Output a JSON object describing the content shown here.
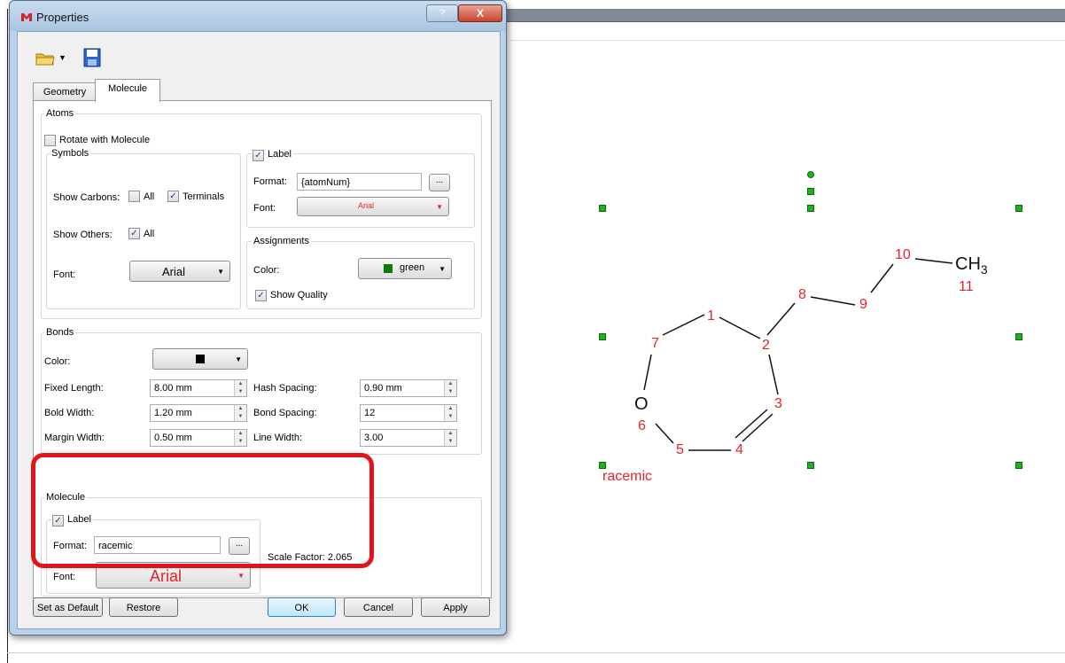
{
  "window": {
    "title": "Properties",
    "help_label": "?",
    "close_label": "X"
  },
  "icons": {
    "app": "app-logo-icon",
    "folder": "open-folder-icon",
    "dropdown": "dropdown-arrow-icon",
    "save": "save-icon"
  },
  "tabs": [
    "Geometry",
    "Molecule"
  ],
  "atoms": {
    "group_label": "Atoms",
    "rotate_label": "Rotate with Molecule",
    "rotate_checked": false,
    "symbols": {
      "group_label": "Symbols",
      "show_carbons_label": "Show Carbons:",
      "all_label": "All",
      "all_checked": false,
      "terminals_label": "Terminals",
      "terminals_checked": true,
      "show_others_label": "Show Others:",
      "others_all_label": "All",
      "others_all_checked": true,
      "font_label": "Font:",
      "font_value": "Arial"
    },
    "label": {
      "label": "Label",
      "checked": true,
      "format_label": "Format:",
      "format_value": "{atomNum}",
      "dots_label": "...",
      "font_label": "Font:",
      "font_value": "Arial"
    },
    "assignments": {
      "group_label": "Assignments",
      "color_label": "Color:",
      "color_value": "green",
      "show_quality_label": "Show Quality",
      "show_quality_checked": true
    }
  },
  "bonds": {
    "group_label": "Bonds",
    "color_label": "Color:",
    "fixed_length_label": "Fixed Length:",
    "fixed_length_value": "8.00 mm",
    "hash_spacing_label": "Hash Spacing:",
    "hash_spacing_value": "0.90 mm",
    "bold_width_label": "Bold Width:",
    "bold_width_value": "1.20 mm",
    "bond_spacing_label": "Bond Spacing:",
    "bond_spacing_value": "12",
    "margin_width_label": "Margin Width:",
    "margin_width_value": "0.50 mm",
    "line_width_label": "Line Width:",
    "line_width_value": "3.00"
  },
  "molecule": {
    "group_label": "Molecule",
    "label": "Label",
    "label_checked": true,
    "format_label": "Format:",
    "format_value": "racemic",
    "dots_label": "...",
    "font_label": "Font:",
    "font_value": "Arial",
    "scale_factor_text": "Scale Factor: 2.065"
  },
  "buttons": {
    "set_default": "Set as Default",
    "restore": "Restore",
    "ok": "OK",
    "cancel": "Cancel",
    "apply": "Apply"
  },
  "colors": {
    "atom_label_red": "#e3242b",
    "assignment_green": "#0e7a0e",
    "highlight_red": "#e0141a"
  },
  "structure": {
    "atom_numbers": [
      "1",
      "2",
      "3",
      "4",
      "5",
      "6",
      "7",
      "8",
      "9",
      "10",
      "11"
    ],
    "oxygen_symbol": "O",
    "methyl_ch": "CH",
    "methyl_sub": "3",
    "molecule_label": "racemic"
  }
}
